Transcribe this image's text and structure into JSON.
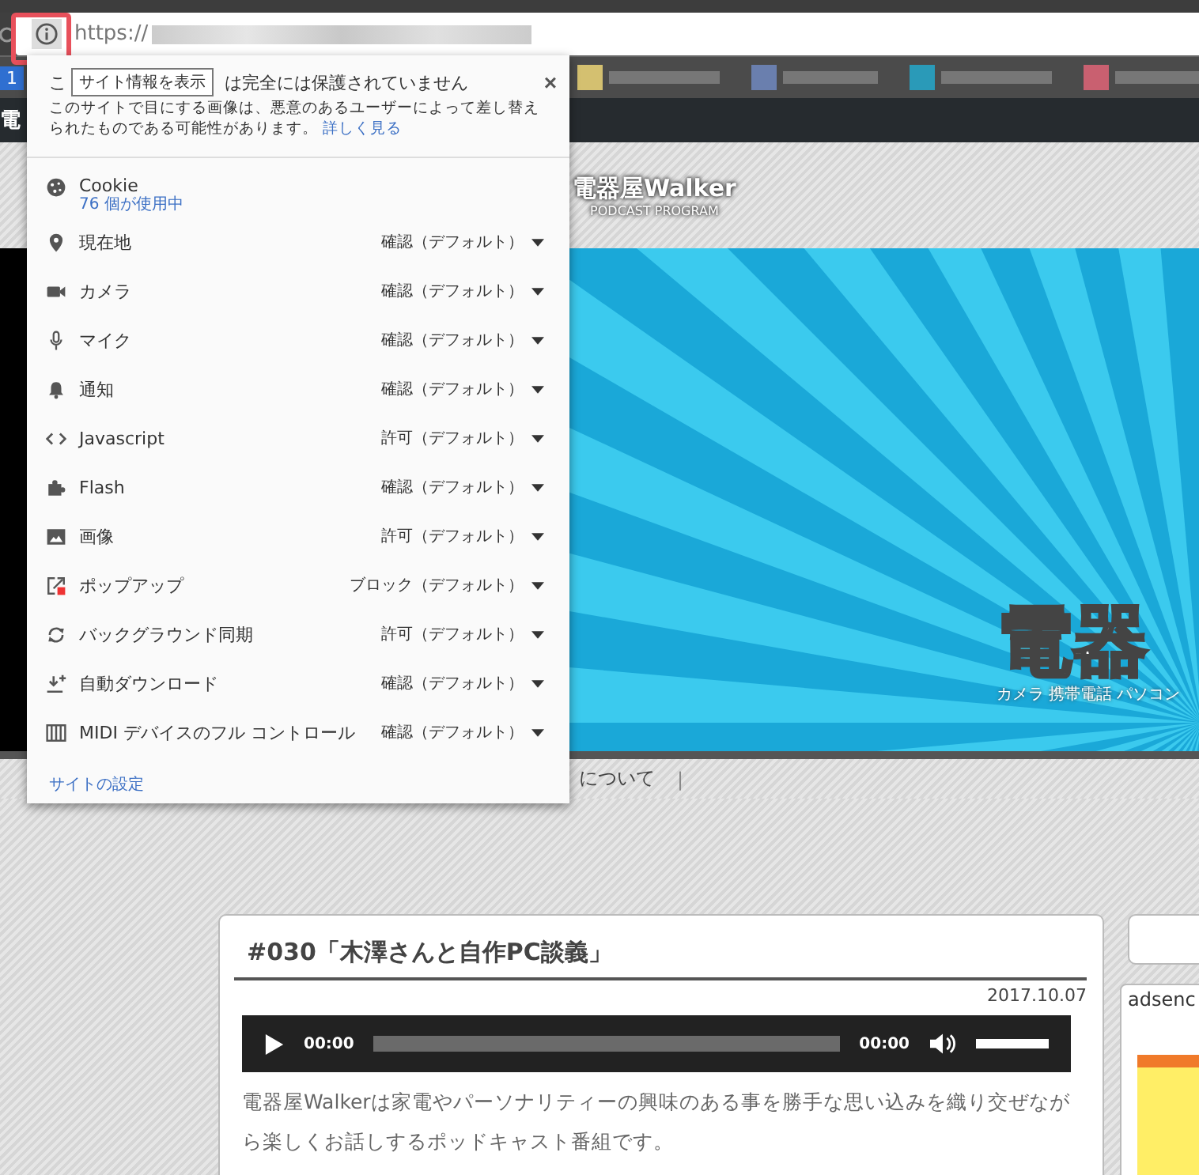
{
  "address_bar": {
    "scheme": "https://"
  },
  "bookmarks_bar": {
    "badge": "1"
  },
  "site_nav": {
    "logo_fragment": "電"
  },
  "site_header": {
    "title": "電器屋Walker",
    "subtitle": "PODCAST PROGRAM"
  },
  "banner": {
    "logo": "電器",
    "tagline": [
      "カメラ",
      "携帯電話",
      "パソコン"
    ]
  },
  "nav": {
    "item_fragment": "について",
    "separator": "|"
  },
  "site_info_popup": {
    "tooltip": "サイト情報を表示",
    "heading_start": "こ",
    "heading_end": "は完全には保護されていません",
    "description": "このサイトで目にする画像は、悪意のあるユーザーによって差し替えられたものである可能性があります。",
    "learn_more": "詳しく見る",
    "close": "×",
    "permissions": [
      {
        "kind": "cookie",
        "label": "Cookie",
        "detail": "76 個が使用中"
      },
      {
        "kind": "setting",
        "label": "現在地",
        "value": "確認（デフォルト）"
      },
      {
        "kind": "setting",
        "label": "カメラ",
        "value": "確認（デフォルト）"
      },
      {
        "kind": "setting",
        "label": "マイク",
        "value": "確認（デフォルト）"
      },
      {
        "kind": "setting",
        "label": "通知",
        "value": "確認（デフォルト）"
      },
      {
        "kind": "setting",
        "label": "Javascript",
        "value": "許可（デフォルト）"
      },
      {
        "kind": "setting",
        "label": "Flash",
        "value": "確認（デフォルト）"
      },
      {
        "kind": "setting",
        "label": "画像",
        "value": "許可（デフォルト）"
      },
      {
        "kind": "setting",
        "label": "ポップアップ",
        "value": "ブロック（デフォルト）"
      },
      {
        "kind": "setting",
        "label": "バックグラウンド同期",
        "value": "許可（デフォルト）"
      },
      {
        "kind": "setting",
        "label": "自動ダウンロード",
        "value": "確認（デフォルト）"
      },
      {
        "kind": "setting",
        "label": "MIDI デバイスのフル コントロール",
        "value": "確認（デフォルト）"
      }
    ],
    "footer_link": "サイトの設定"
  },
  "article": {
    "title": "#030「木澤さんと自作PC談義」",
    "date": "2017.10.07",
    "player": {
      "current_time": "00:00",
      "progress": {
        "level": 0
      },
      "duration": "00:00",
      "volume": {
        "level": 1
      }
    },
    "body": "電器屋Walkerは家電やパーソナリティーの興味のある事を勝手な思い込みを織り交ぜながら楽しくお話しするポッドキャスト番組です。"
  },
  "sidebar": {
    "widget_title": "adsenc"
  }
}
